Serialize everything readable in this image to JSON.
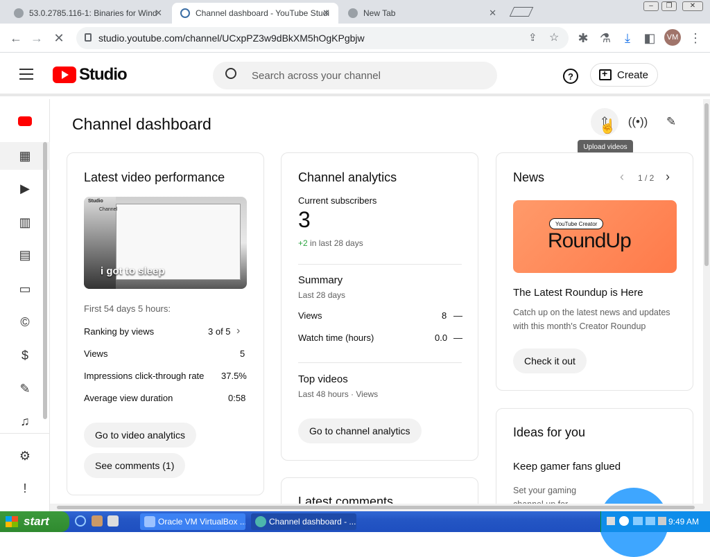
{
  "browser": {
    "tabs": [
      {
        "title": "53.0.2785.116-1: Binaries for Wind"
      },
      {
        "title": "Channel dashboard - YouTube Studi"
      },
      {
        "title": "New Tab"
      }
    ],
    "url": "studio.youtube.com/channel/UCxpPZ3w9dBkXM5hOgKPgbjw",
    "profile_initials": "VM"
  },
  "header": {
    "logo_text": "Studio",
    "search_placeholder": "Search across your channel",
    "create_label": "Create",
    "help_glyph": "?"
  },
  "sidebar": {
    "items": [
      {
        "icon": "channel-avatar-icon"
      },
      {
        "icon": "dashboard-icon"
      },
      {
        "icon": "content-icon"
      },
      {
        "icon": "analytics-icon"
      },
      {
        "icon": "comments-icon"
      },
      {
        "icon": "subtitles-icon"
      },
      {
        "icon": "copyright-icon"
      },
      {
        "icon": "earn-icon"
      },
      {
        "icon": "customization-icon"
      },
      {
        "icon": "audio-library-icon"
      },
      {
        "icon": "settings-icon"
      },
      {
        "icon": "feedback-icon"
      }
    ]
  },
  "main": {
    "title": "Channel dashboard",
    "tooltip": "Upload videos",
    "latest_video": {
      "title": "Latest video performance",
      "thumb_logo": "Studio",
      "thumb_header": "Channel",
      "thumb_title": "i got to sleep",
      "period": "First 54 days 5 hours:",
      "rows": [
        {
          "label": "Ranking by views",
          "value": "3 of 5"
        },
        {
          "label": "Views",
          "value": "5"
        },
        {
          "label": "Impressions click-through rate",
          "value": "37.5%"
        },
        {
          "label": "Average view duration",
          "value": "0:58"
        }
      ],
      "btn_analytics": "Go to video analytics",
      "btn_comments": "See comments (1)"
    },
    "analytics": {
      "title": "Channel analytics",
      "subs_label": "Current subscribers",
      "subs_value": "3",
      "subs_change": "+2 in last 28 days",
      "summary_title": "Summary",
      "summary_period": "Last 28 days",
      "rows": [
        {
          "label": "Views",
          "value": "8",
          "trend": "—"
        },
        {
          "label": "Watch time (hours)",
          "value": "0.0",
          "trend": "—"
        }
      ],
      "top_title": "Top videos",
      "top_period": "Last 48 hours · Views",
      "btn": "Go to channel analytics"
    },
    "comments": {
      "title": "Latest comments"
    },
    "news": {
      "title": "News",
      "pager": "1 / 2",
      "img_badge": "YouTube Creator",
      "img_big": "RoundUp",
      "headline": "The Latest Roundup is Here",
      "body": "Catch up on the latest news and updates with this month's Creator Roundup",
      "btn": "Check it out"
    },
    "ideas": {
      "title": "Ideas for you",
      "headline": "Keep gamer fans glued",
      "body": "Set your gaming channel up for"
    }
  },
  "taskbar": {
    "start": "start",
    "tasks": [
      {
        "label": "Oracle VM VirtualBox ..."
      },
      {
        "label": "Channel dashboard - ..."
      }
    ],
    "clock": "9:49 AM"
  }
}
